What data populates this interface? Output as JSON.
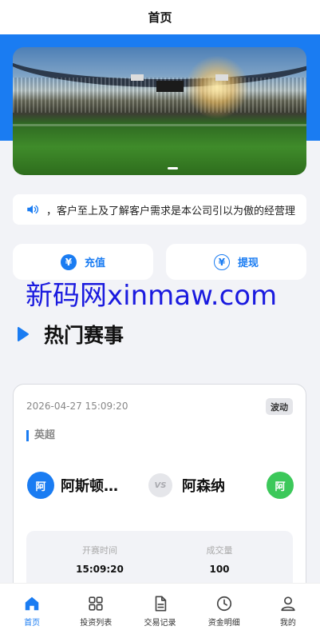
{
  "header": {
    "title": "首页"
  },
  "notice": {
    "text": "，客户至上及了解客户需求是本公司引以为傲的经营理"
  },
  "actions": {
    "recharge_label": "充值",
    "withdraw_label": "提现",
    "coin_glyph": "¥"
  },
  "watermark": {
    "text": "新码网xinmaw.com"
  },
  "section": {
    "title": "热门赛事"
  },
  "match": {
    "datetime": "2026-04-27 15:09:20",
    "status": "波动",
    "league": "英超",
    "home": {
      "badge": "阿",
      "name": "阿斯顿…",
      "color": "#1a7cf2"
    },
    "vs": "VS",
    "away": {
      "badge": "阿",
      "name": "阿森纳",
      "color": "#3cc85a"
    },
    "info": [
      {
        "label": "开赛时间",
        "value": "15:09:20"
      },
      {
        "label": "成交量",
        "value": "100"
      }
    ]
  },
  "tabbar": {
    "items": [
      {
        "label": "首页",
        "icon": "home-icon",
        "active": true
      },
      {
        "label": "投资列表",
        "icon": "grid-icon",
        "active": false
      },
      {
        "label": "交易记录",
        "icon": "document-icon",
        "active": false
      },
      {
        "label": "资金明细",
        "icon": "clock-icon",
        "active": false
      },
      {
        "label": "我的",
        "icon": "user-icon",
        "active": false
      }
    ]
  },
  "colors": {
    "accent": "#1a7cf2",
    "page_bg": "#f2f3f7",
    "away_badge": "#3cc85a"
  }
}
